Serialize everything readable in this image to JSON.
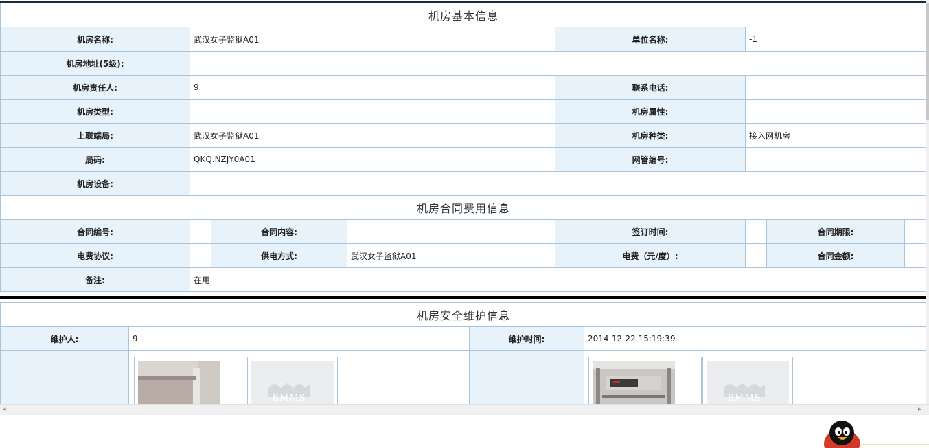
{
  "basic": {
    "title": "机房基本信息",
    "name_label": "机房名称:",
    "name_value": "武汉女子监狱A01",
    "unit_label": "单位名称:",
    "unit_value": "-1",
    "address_label": "机房地址(5级):",
    "address_value": "",
    "manager_label": "机房责任人:",
    "manager_value": "9",
    "phone_label": "联系电话:",
    "phone_value": "",
    "type_label": "机房类型:",
    "type_value": "",
    "attr_label": "机房属性:",
    "attr_value": "",
    "upstream_label": "上联端局:",
    "upstream_value": "武汉女子监狱A01",
    "kind_label": "机房种类:",
    "kind_value": "接入网机房",
    "code_label": "局码:",
    "code_value": "QKQ.NZJY0A01",
    "nms_label": "网管编号:",
    "nms_value": "",
    "device_label": "机房设备:",
    "device_value": ""
  },
  "contract": {
    "title": "机房合同费用信息",
    "no_label": "合同编号:",
    "no_value": "",
    "content_label": "合同内容:",
    "content_value": "",
    "sign_label": "签订时间:",
    "sign_value": "",
    "period_label": "合同期限:",
    "period_value": "",
    "elec_agreement_label": "电费协议:",
    "elec_agreement_value": "",
    "power_mode_label": "供电方式:",
    "power_mode_value": "武汉女子监狱A01",
    "elec_price_label": "电费（元/度）:",
    "elec_price_value": "",
    "amount_label": "合同金额:",
    "amount_value": "",
    "remark_label": "备注:",
    "remark_value": "在用"
  },
  "maintenance": {
    "title": "机房安全维护信息",
    "person_label": "维护人:",
    "person_value": "9",
    "time_label": "维护时间:",
    "time_value": "2014-12-22 15:19:39",
    "placeholder_text": "BMMS"
  },
  "colors": {
    "label_bg": "#e7f2fb",
    "border": "#a9c4dc"
  },
  "icons": {
    "scroll_left": "◂",
    "scroll_right": "▸",
    "mascot": "qq-penguin-icon"
  }
}
